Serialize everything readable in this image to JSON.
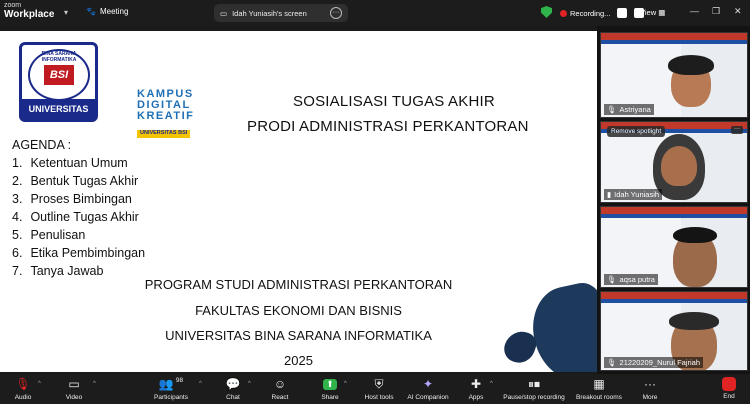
{
  "app": {
    "brand_top": "zoom",
    "brand_name": "Workplace",
    "meeting_label": "Meeting"
  },
  "share": {
    "label": "Idah Yuniasih's screen"
  },
  "recording": {
    "label": "Recording..."
  },
  "view": {
    "label": "View"
  },
  "slide": {
    "logo": {
      "ring_text": "BINA SARANA INFORMATIKA",
      "mark": "BSI",
      "univ": "UNIVERSITAS"
    },
    "kampus": {
      "line1": "KAMPUS",
      "line2": "DIGITAL",
      "line3": "KREATIF",
      "badge": "UNIVERSITAS BSI"
    },
    "title_line1": "SOSIALISASI TUGAS AKHIR",
    "title_line2": "PRODI ADMINISTRASI PERKANTORAN",
    "agenda_heading": "AGENDA :",
    "agenda": [
      {
        "num": "1.",
        "text": "Ketentuan Umum"
      },
      {
        "num": "2.",
        "text": "Bentuk Tugas Akhir"
      },
      {
        "num": "3.",
        "text": "Proses Bimbingan"
      },
      {
        "num": "4.",
        "text": "Outline Tugas Akhir"
      },
      {
        "num": "5.",
        "text": "Penulisan"
      },
      {
        "num": "6.",
        "text": "Etika Pembimbingan"
      },
      {
        "num": "7.",
        "text": "Tanya Jawab"
      }
    ],
    "program": "PROGRAM STUDI ADMINISTRASI PERKANTORAN",
    "faculty": "FAKULTAS EKONOMI DAN BISNIS",
    "university": "UNIVERSITAS BINA SARANA INFORMATIKA",
    "year": "2025"
  },
  "participants_panel": {
    "spotlight_label": "Remove spotlight",
    "tiles": [
      {
        "name": "Astriyana",
        "skin": "#b77a55",
        "hair": "#1d1d1d"
      },
      {
        "name": "Idah Yuniasih",
        "skin": "#a86f4c",
        "hair": "#3a3a3a"
      },
      {
        "name": "aqsa putra",
        "skin": "#9a6a4a",
        "hair": "#141414"
      },
      {
        "name": "21220209_Nurul Fajriah",
        "skin": "#a5714f",
        "hair": "#2a2a2a"
      }
    ]
  },
  "toolbar": {
    "audio": "Audio",
    "video": "Video",
    "participants": "Participants",
    "participants_count": "98",
    "chat": "Chat",
    "react": "React",
    "share": "Share",
    "host_tools": "Host tools",
    "ai_companion": "AI Companion",
    "apps": "Apps",
    "pause_recording": "Pause/stop recording",
    "breakout": "Breakout rooms",
    "more": "More",
    "end": "End"
  },
  "colors": {
    "accent": "#1a2a8a",
    "record": "#e02424",
    "shield": "#2fb34a",
    "slide_bg": "#ffffff"
  }
}
